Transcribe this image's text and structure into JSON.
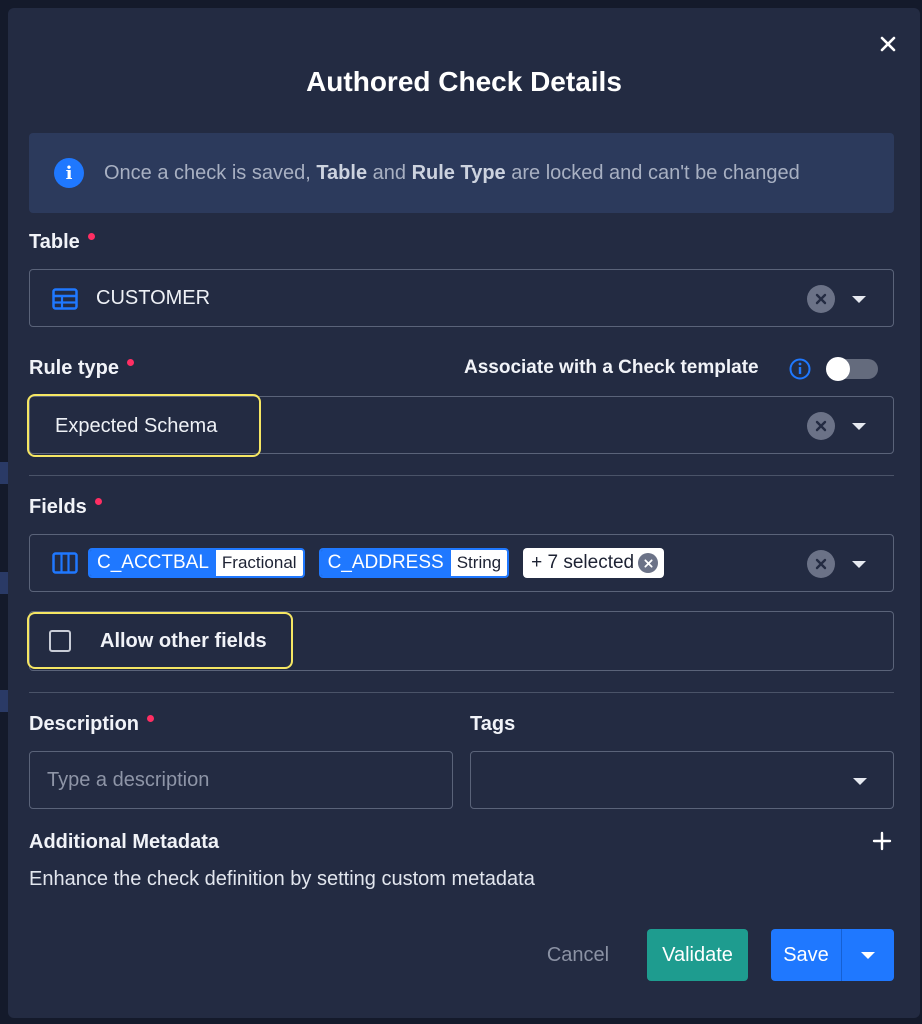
{
  "dialog": {
    "title": "Authored Check Details"
  },
  "info": {
    "prefix": "Once a check is saved, ",
    "bold1": "Table",
    "middle": " and ",
    "bold2": "Rule Type",
    "suffix": " are locked and can't be changed"
  },
  "table": {
    "label": "Table",
    "value": "CUSTOMER"
  },
  "rule_type": {
    "label": "Rule type",
    "value": "Expected Schema",
    "template_label": "Associate with a Check template",
    "template_enabled": false
  },
  "fields": {
    "label": "Fields",
    "chips": [
      {
        "name": "C_ACCTBAL",
        "type": "Fractional"
      },
      {
        "name": "C_ADDRESS",
        "type": "String"
      }
    ],
    "more_label": "+ 7 selected",
    "allow_other_label": "Allow other fields",
    "allow_other_checked": false
  },
  "description": {
    "label": "Description",
    "placeholder": "Type a description"
  },
  "tags": {
    "label": "Tags"
  },
  "metadata": {
    "title": "Additional Metadata",
    "subtitle": "Enhance the check definition by setting custom metadata"
  },
  "actions": {
    "cancel": "Cancel",
    "validate": "Validate",
    "save": "Save"
  },
  "colors": {
    "accent": "#1f78ff",
    "validate": "#1e9c8f",
    "highlight": "#f5e663",
    "required": "#ff2e63"
  }
}
